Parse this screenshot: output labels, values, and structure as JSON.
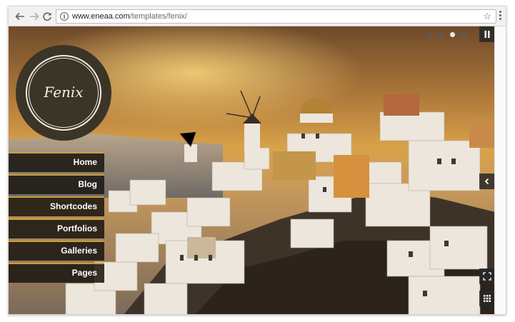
{
  "browser": {
    "url_host": "www.eneaa.com",
    "url_path": "/templates/fenix/"
  },
  "site": {
    "logo_text": "Fenix",
    "menu": [
      {
        "label": "Home"
      },
      {
        "label": "Blog"
      },
      {
        "label": "Shortcodes"
      },
      {
        "label": "Portfolios"
      },
      {
        "label": "Galleries"
      },
      {
        "label": "Pages"
      }
    ],
    "slider": {
      "slide_count": 4,
      "active_slide": 3
    }
  },
  "icons": {
    "back": "arrow-left-icon",
    "forward": "arrow-right-icon",
    "reload": "reload-icon",
    "info": "info-icon",
    "bookmark": "star-icon",
    "menu": "kebab-menu-icon",
    "pause": "pause-icon",
    "next": "chevron-left-icon",
    "fullscreen": "fullscreen-icon",
    "thumbnails": "grid-icon"
  },
  "colors": {
    "menu_accent": "#c8a03a",
    "menu_bg": "#1c1812",
    "logo_bg": "#3b3428"
  }
}
